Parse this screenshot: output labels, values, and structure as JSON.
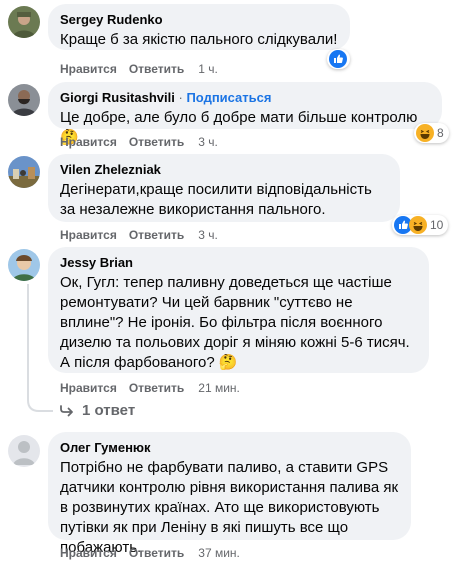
{
  "comments": [
    {
      "author": "Sergey Rudenko",
      "text": "Краще б за якістю пального слідкували!",
      "like": "Нравится",
      "reply": "Ответить",
      "time": "1 ч.",
      "reaction_count": ""
    },
    {
      "author": "Giorgi Rusitashvili",
      "follow_sep": "·",
      "follow": "Подписаться",
      "text": "Це добре, але було б добре мати більше контролю",
      "emoji": "🤔",
      "like": "Нравится",
      "reply": "Ответить",
      "time": "3 ч.",
      "reaction_count": "8"
    },
    {
      "author": "Vilen Zhelezniak",
      "text": "Дегінерати,краще посилити відповідальність за незалежне використання пального.",
      "like": "Нравится",
      "reply": "Ответить",
      "time": "3 ч.",
      "reaction_count": "10"
    },
    {
      "author": "Jessy Brian",
      "text": "Ок, Гугл: тепер паливну доведеться ще частіше ремонтувати? Чи цей барвник \"суттєво не вплине\"? Не іронія. Бо фільтра після воєнного дизелю та польових доріг я міняю кожні 5-6 тисяч. А після фарбованого?",
      "emoji": "🤔",
      "like": "Нравится",
      "reply": "Ответить",
      "time": "21 мин.",
      "replies_link": "1 ответ"
    },
    {
      "author": "Олег Гуменюк",
      "text": "Потрібно не фарбувати паливо, а ставити GPS датчики контролю рівня використання палива як в розвинутих країнах. Ато ще використовують путівки як при Леніну в які пишуть все що побажають.",
      "like": "Нравится",
      "reply": "Ответить",
      "time": "37 мин."
    }
  ],
  "icons": {
    "like": "like-icon",
    "haha": "haha-icon",
    "reply_arrow": "reply-arrow-icon"
  },
  "colors": {
    "bubble": "#f0f2f5",
    "like_blue": "#1877f2",
    "follow_blue": "#1b74e4",
    "meta_gray": "#65676b"
  }
}
